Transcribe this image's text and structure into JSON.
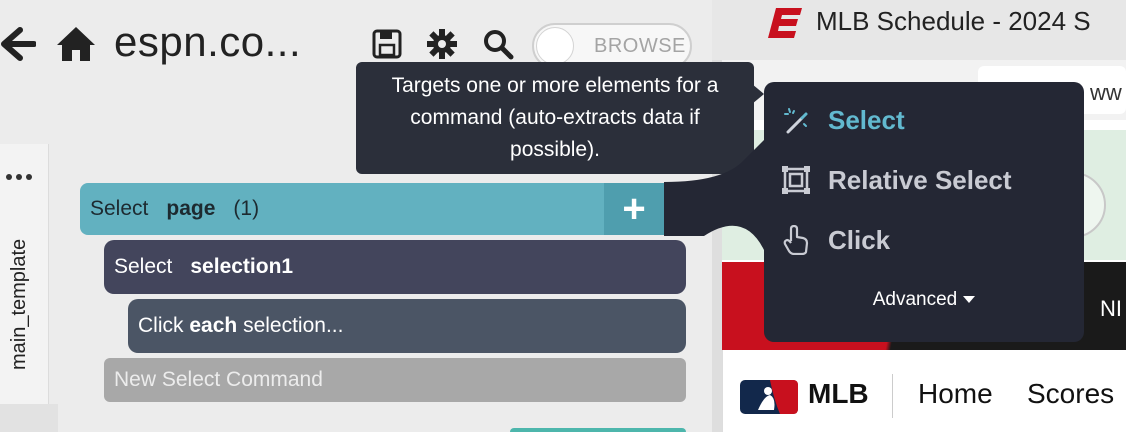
{
  "header": {
    "url": "espn.co...",
    "browse_label": "BROWSE"
  },
  "template": {
    "tab_label": "main_template"
  },
  "commands": {
    "select_page": {
      "verb": "Select",
      "target": "page",
      "count": "(1)"
    },
    "select_selection": {
      "verb": "Select",
      "target": "selection1"
    },
    "click_each": {
      "verb": "Click",
      "each": "each",
      "rest": "selection..."
    },
    "new_command": "New Select Command"
  },
  "tooltip": {
    "text": "Targets one or more elements for a command (auto-extracts data if possible)."
  },
  "menu": {
    "items": [
      {
        "label": "Select",
        "icon": "magic-wand-icon",
        "active": true
      },
      {
        "label": "Relative Select",
        "icon": "relative-select-icon",
        "active": false
      },
      {
        "label": "Click",
        "icon": "pointer-hand-icon",
        "active": false
      }
    ],
    "advanced_label": "Advanced"
  },
  "browser": {
    "tab_title": "MLB Schedule - 2024 S",
    "address_text": "ww",
    "nav_partial": "NI",
    "mlb_label": "MLB",
    "nav_links": [
      "Home",
      "Scores"
    ]
  },
  "colors": {
    "accent_teal": "#62b1c0",
    "command_dark": "#43455c",
    "menu_bg": "#242734",
    "menu_active": "#62b9cf",
    "espn_red": "#c8101e"
  }
}
